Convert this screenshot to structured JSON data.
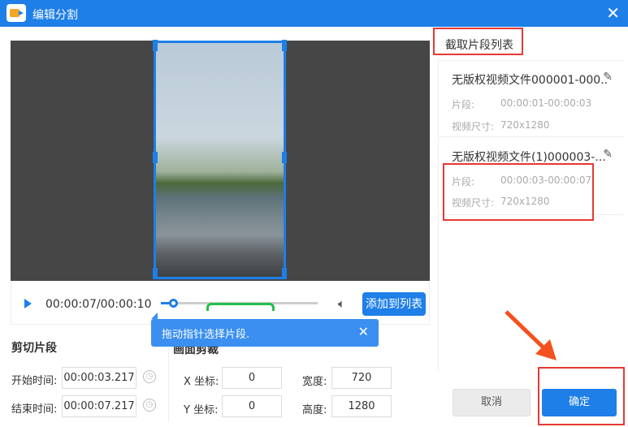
{
  "window": {
    "title": "编辑分割",
    "close_icon": "close-icon"
  },
  "player": {
    "time": "00:00:07/00:00:10",
    "add_label": "添加到列表",
    "progress_fraction": 0.07,
    "segment": [
      0.3,
      0.73
    ]
  },
  "tooltip": {
    "text": "拖动指针选择片段."
  },
  "cut": {
    "heading": "剪切片段",
    "start_label": "开始时间:",
    "start_value": "00:00:03.217",
    "end_label": "结束时间:",
    "end_value": "00:00:07.217"
  },
  "crop": {
    "heading": "画面剪裁",
    "x_label": "X 坐标:",
    "x_value": "0",
    "y_label": "Y 坐标:",
    "y_value": "0",
    "w_label": "宽度:",
    "w_value": "720",
    "h_label": "高度:",
    "h_value": "1280"
  },
  "list": {
    "title": "截取片段列表",
    "items": [
      {
        "name": "无版权视频文件000001-000..",
        "seg_label": "片段:",
        "seg_value": "00:00:01-00:00:03",
        "size_label": "视频尺寸:",
        "size_value": "720x1280"
      },
      {
        "name": "无版权视频文件(1)000003-...",
        "seg_label": "片段:",
        "seg_value": "00:00:03-00:00:07",
        "size_label": "视频尺寸:",
        "size_value": "720x1280"
      }
    ]
  },
  "footer": {
    "cancel": "取消",
    "ok": "确定"
  },
  "colors": {
    "accent": "#1e7fe8",
    "highlight": "#e53935",
    "segment": "#22c04a"
  }
}
